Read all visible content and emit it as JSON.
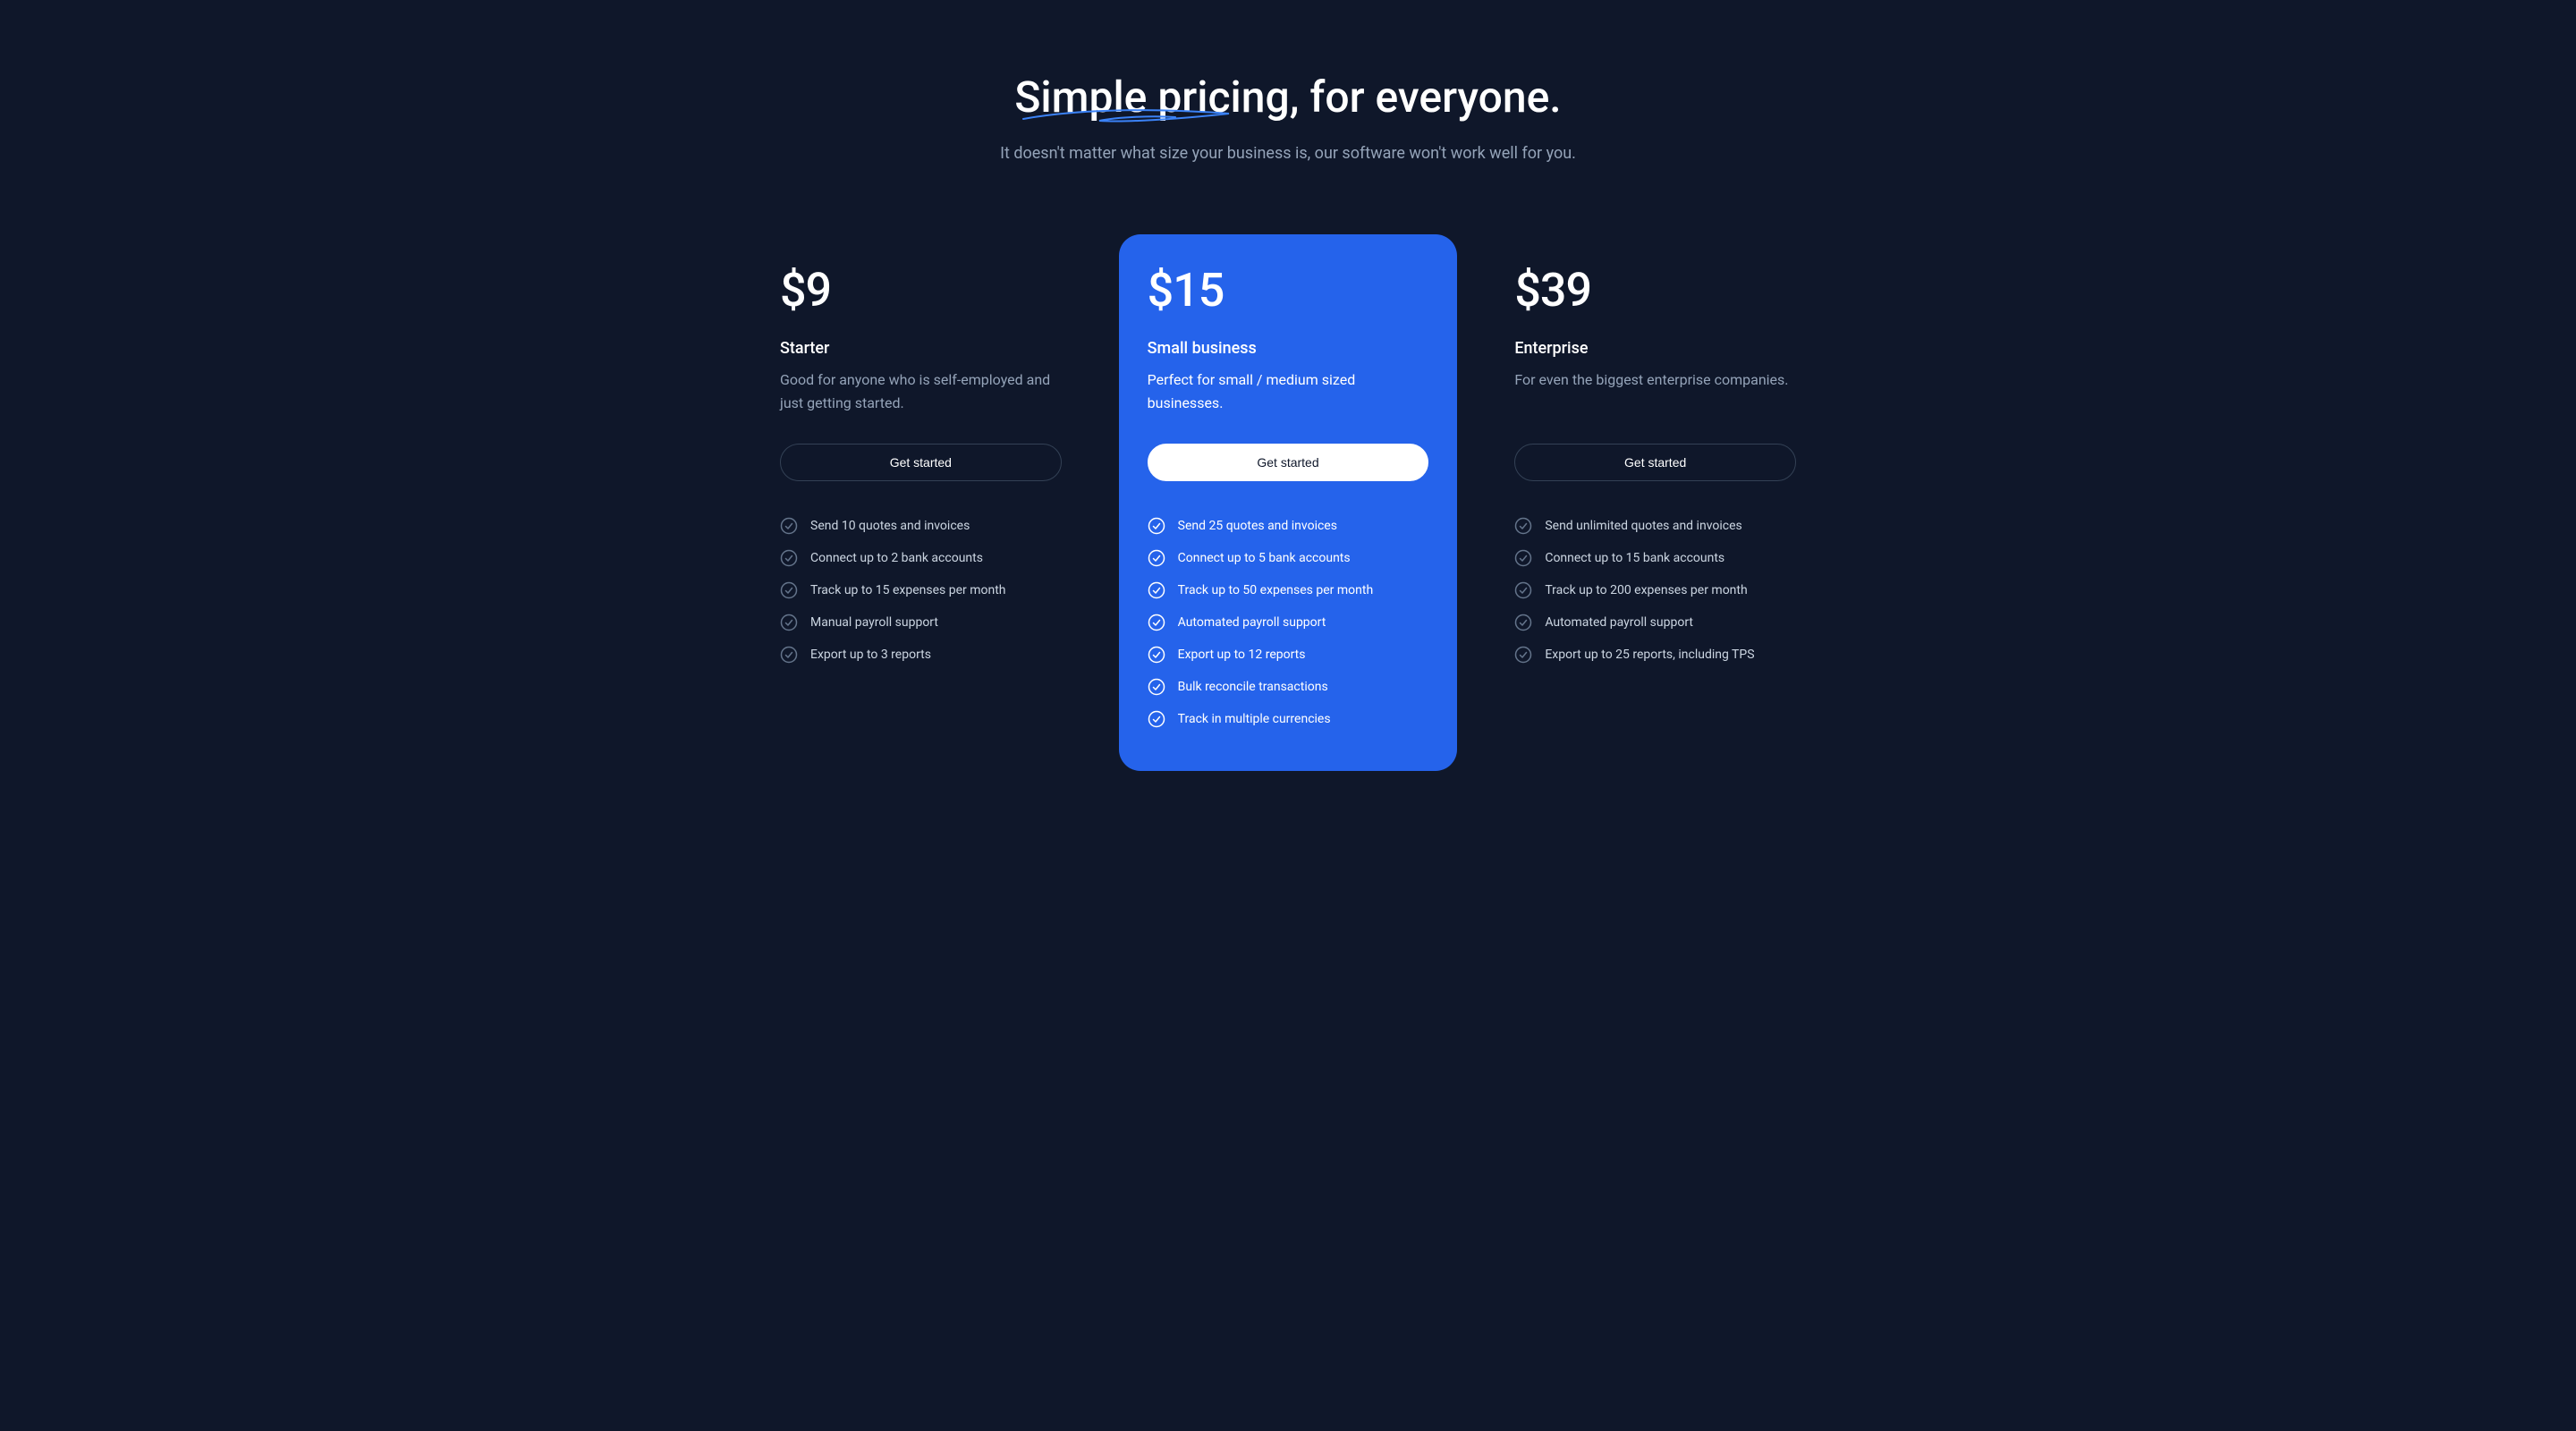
{
  "header": {
    "title": "Simple pricing, for everyone.",
    "subtitle": "It doesn't matter what size your business is, our software won't work well for you."
  },
  "plans": [
    {
      "price": "$9",
      "name": "Starter",
      "description": "Good for anyone who is self-employed and just getting started.",
      "cta": "Get started",
      "featured": false,
      "features": [
        "Send 10 quotes and invoices",
        "Connect up to 2 bank accounts",
        "Track up to 15 expenses per month",
        "Manual payroll support",
        "Export up to 3 reports"
      ]
    },
    {
      "price": "$15",
      "name": "Small business",
      "description": "Perfect for small / medium sized businesses.",
      "cta": "Get started",
      "featured": true,
      "features": [
        "Send 25 quotes and invoices",
        "Connect up to 5 bank accounts",
        "Track up to 50 expenses per month",
        "Automated payroll support",
        "Export up to 12 reports",
        "Bulk reconcile transactions",
        "Track in multiple currencies"
      ]
    },
    {
      "price": "$39",
      "name": "Enterprise",
      "description": "For even the biggest enterprise companies.",
      "cta": "Get started",
      "featured": false,
      "features": [
        "Send unlimited quotes and invoices",
        "Connect up to 15 bank accounts",
        "Track up to 200 expenses per month",
        "Automated payroll support",
        "Export up to 25 reports, including TPS"
      ]
    }
  ]
}
